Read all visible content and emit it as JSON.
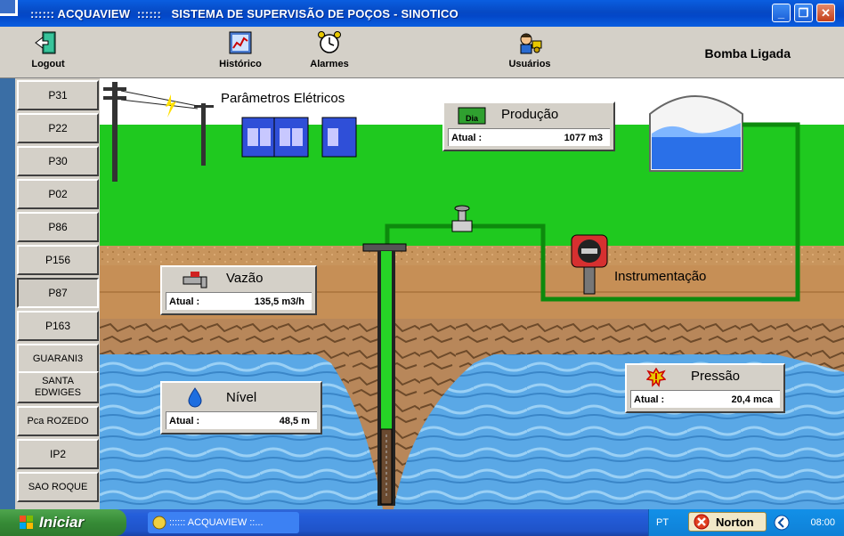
{
  "window": {
    "title": ":::::: ACQUAVIEW  ::::::   SISTEMA DE SUPERVISÃO DE POÇOS - SINOTICO",
    "min_glyph": "_",
    "max_glyph": "❐",
    "close_glyph": "✕"
  },
  "toolbar": {
    "logout": "Logout",
    "historico": "Histórico",
    "alarmes": "Alarmes",
    "usuarios": "Usuários",
    "pump_status": "Bomba Ligada"
  },
  "sidebar": {
    "items": [
      "P31",
      "P22",
      "P30",
      "P02",
      "P86",
      "P156",
      "P87",
      "P163",
      "GUARANI3",
      "SANTA EDWIGES",
      "Pca ROZEDO",
      "IP2",
      "SAO ROQUE"
    ],
    "active_index": 6
  },
  "scene": {
    "parametros_eletricos": "Parâmetros Elétricos",
    "instrumentacao": "Instrumentação",
    "producao": {
      "title": "Produção",
      "badge": "Dia",
      "label": "Atual :",
      "value": "1077 m3"
    },
    "vazao": {
      "title": "Vazão",
      "label": "Atual :",
      "value": "135,5 m3/h"
    },
    "nivel": {
      "title": "Nível",
      "label": "Atual :",
      "value": "48,5 m"
    },
    "pressao": {
      "title": "Pressão",
      "label": "Atual :",
      "value": "20,4 mca"
    }
  },
  "colors": {
    "sky": "#ffffff",
    "grass": "#1fc91f",
    "soil": "#c8955d",
    "rock": "#a67a4e",
    "water": "#4aa0e0",
    "pipe": "#00a000",
    "window_title_bar": "#0a5ee0",
    "panel_bg": "#d4d0c8"
  },
  "taskbar": {
    "start": "Iniciar",
    "task": ":::::: ACQUAVIEW  ::...",
    "lang": "PT",
    "norton": "Norton",
    "clock": "08:00"
  }
}
